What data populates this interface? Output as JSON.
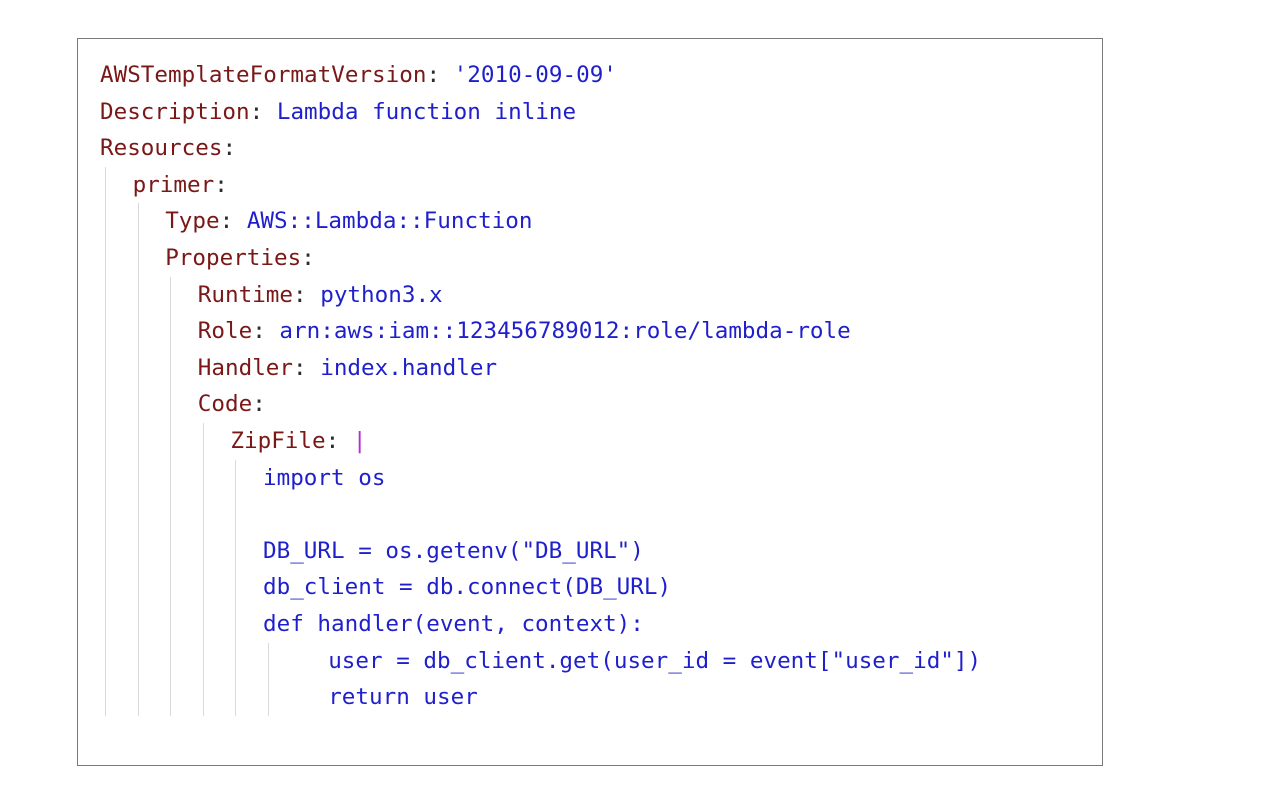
{
  "editor": {
    "lines": [
      {
        "key": "AWSTemplateFormatVersion",
        "colon": ":",
        "value": " '2010-09-09'",
        "indent": 0,
        "guides": 0
      },
      {
        "key": "Description",
        "colon": ":",
        "value": " Lambda function inline",
        "indent": 0,
        "guides": 0
      },
      {
        "key": "Resources",
        "colon": ":",
        "value": "",
        "indent": 0,
        "guides": 0
      },
      {
        "key": "primer",
        "colon": ":",
        "value": "",
        "indent": 1,
        "guides": 1
      },
      {
        "key": "Type",
        "colon": ":",
        "value": " AWS::Lambda::Function",
        "indent": 2,
        "guides": 2
      },
      {
        "key": "Properties",
        "colon": ":",
        "value": "",
        "indent": 2,
        "guides": 2
      },
      {
        "key": "Runtime",
        "colon": ":",
        "value": " python3.x",
        "indent": 3,
        "guides": 3
      },
      {
        "key": "Role",
        "colon": ":",
        "value": " arn:aws:iam::123456789012:role/lambda-role",
        "indent": 3,
        "guides": 3
      },
      {
        "key": "Handler",
        "colon": ":",
        "value": " index.handler",
        "indent": 3,
        "guides": 3
      },
      {
        "key": "Code",
        "colon": ":",
        "value": "",
        "indent": 3,
        "guides": 3
      },
      {
        "key": "ZipFile",
        "colon": ":",
        "value": "",
        "pipe": " |",
        "indent": 4,
        "guides": 4
      },
      {
        "code": "import os",
        "indent": 5,
        "guides": 5
      },
      {
        "code": "",
        "indent": 5,
        "guides": 5
      },
      {
        "code": "DB_URL = os.getenv(\"DB_URL\")",
        "indent": 5,
        "guides": 5
      },
      {
        "code": "db_client = db.connect(DB_URL)",
        "indent": 5,
        "guides": 5
      },
      {
        "code": "def handler(event, context):",
        "indent": 5,
        "guides": 5
      },
      {
        "code": "user = db_client.get(user_id = event[\"user_id\"])",
        "indent": 7,
        "guides": 6
      },
      {
        "code": "return user",
        "indent": 7,
        "guides": 6
      }
    ]
  },
  "colors": {
    "key": "#7a1717",
    "value": "#1f1fcc",
    "pipe": "#b62bd6",
    "guide": "#d9d9d9",
    "border": "#7a7a7a"
  }
}
